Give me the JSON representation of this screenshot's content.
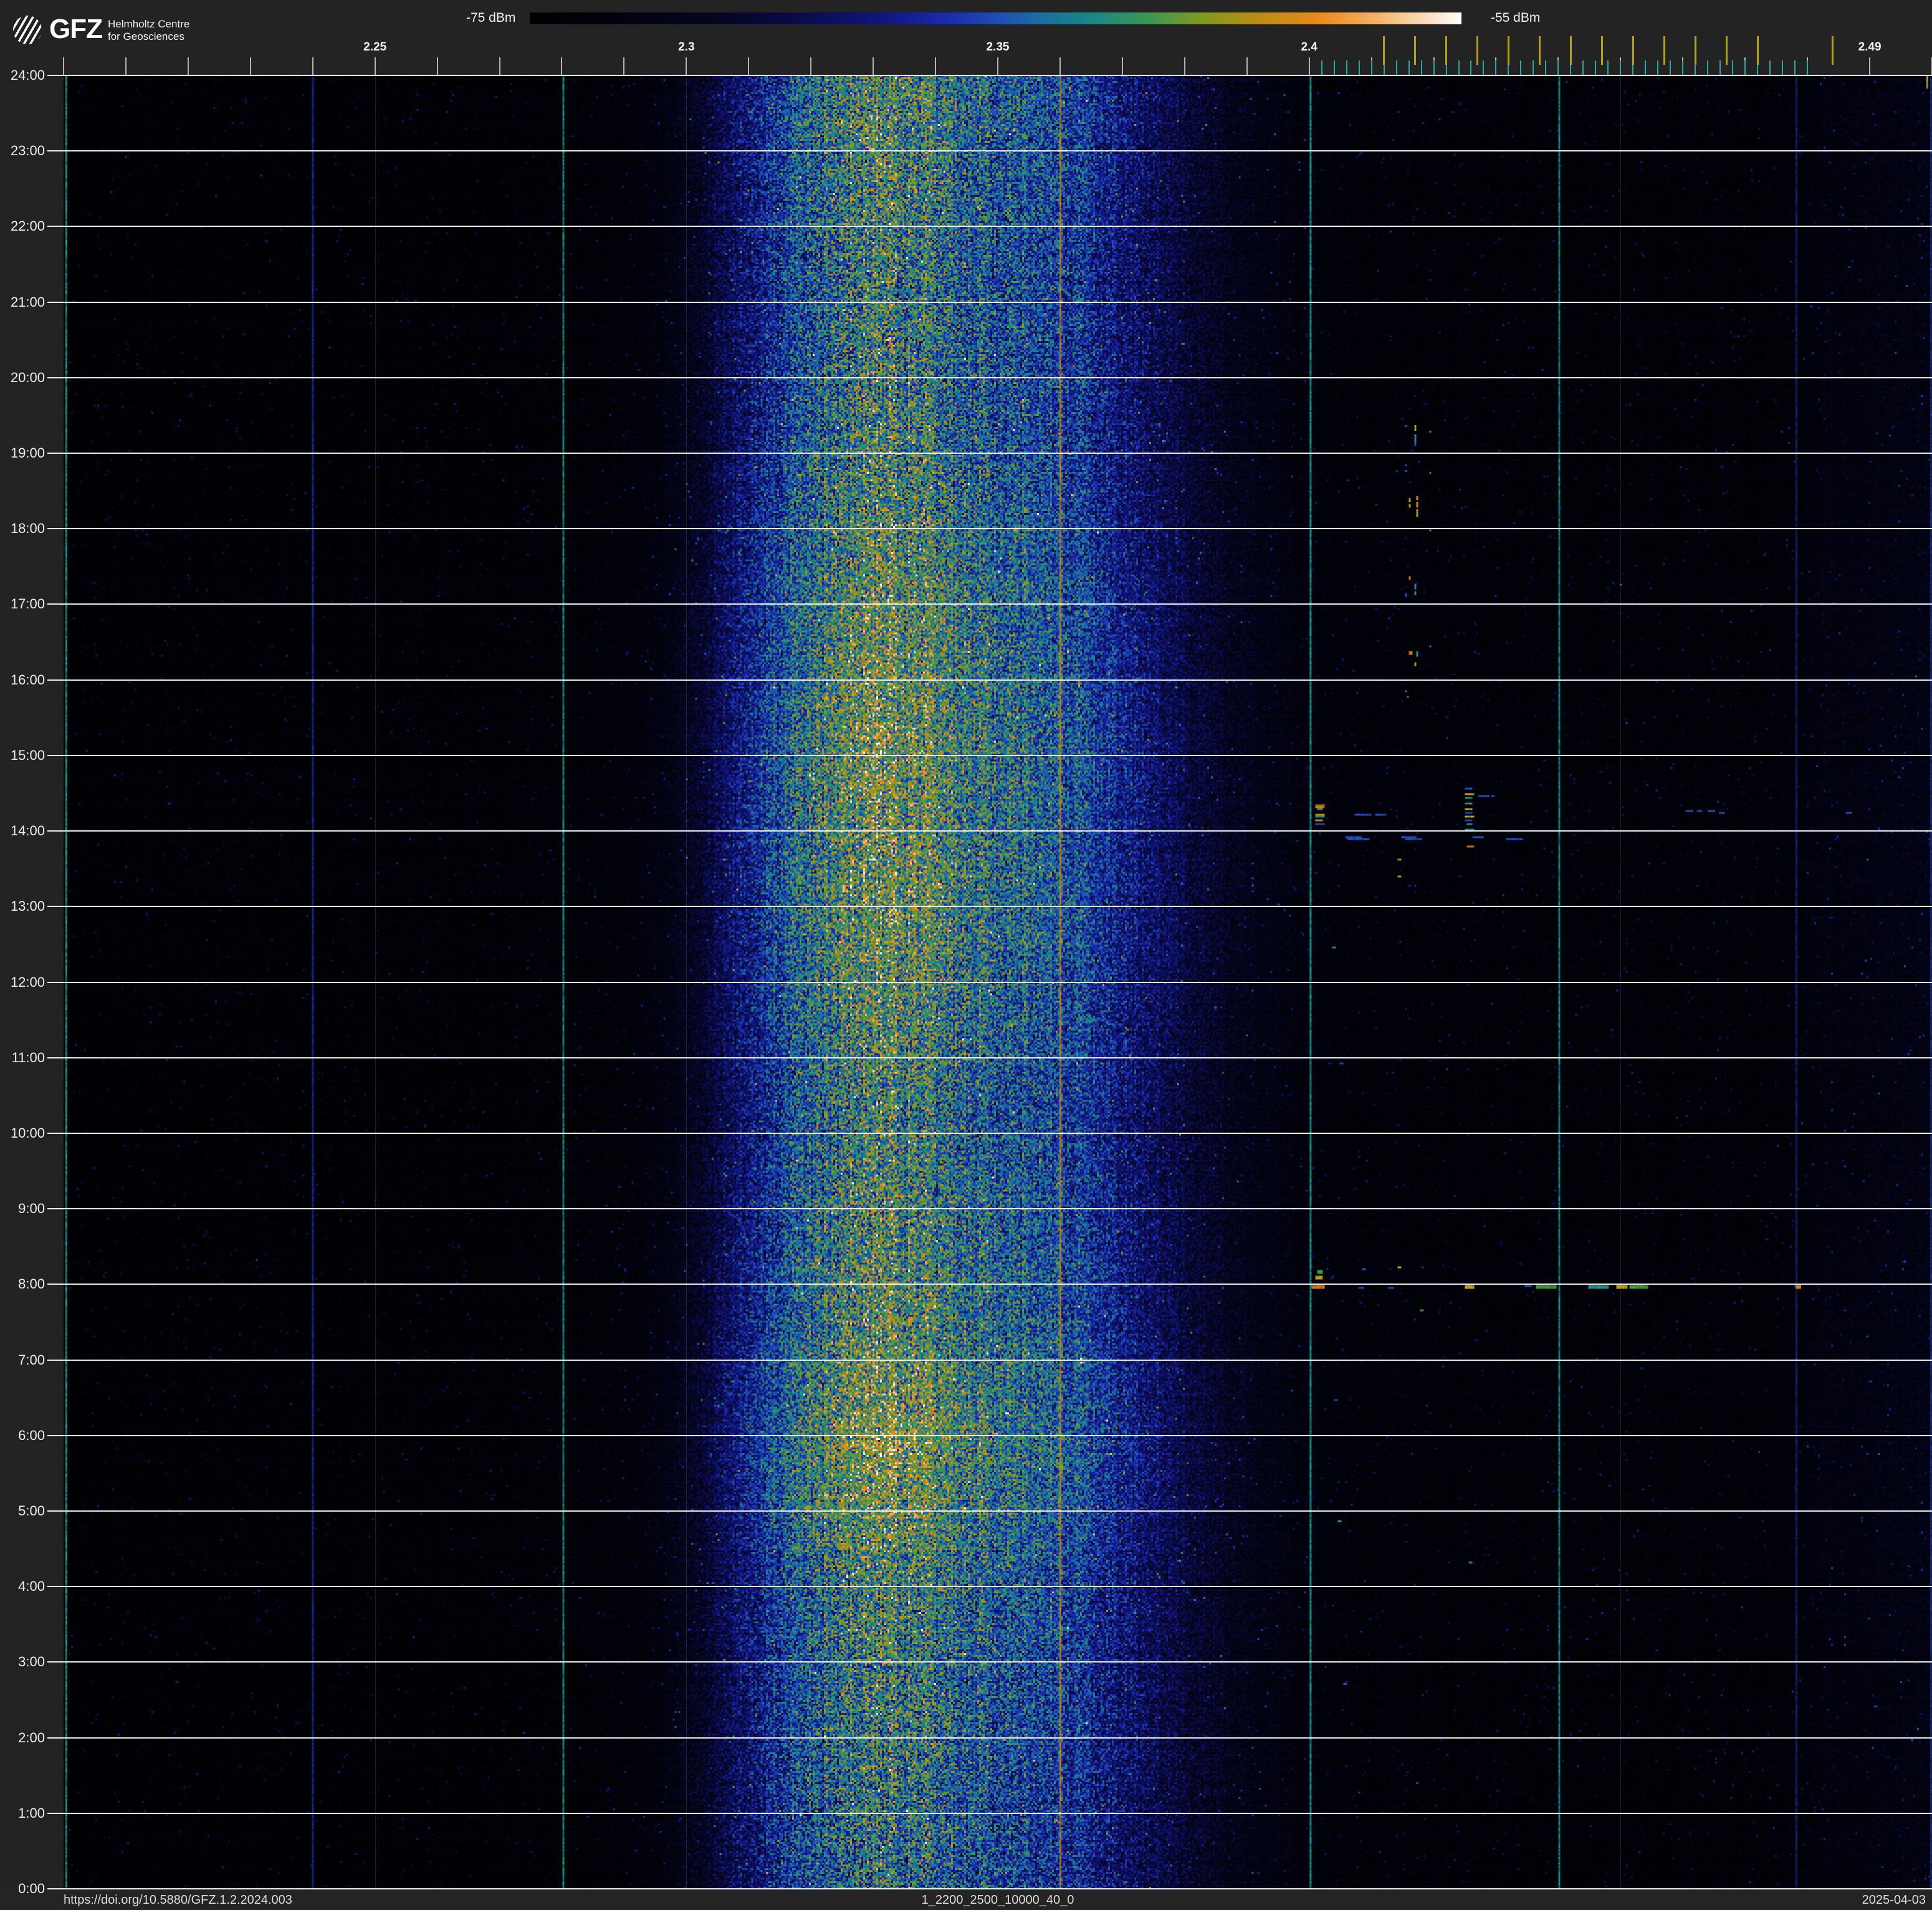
{
  "header": {
    "logo": {
      "org": "GFZ",
      "line1": "Helmholtz Centre",
      "line2": "for Geosciences"
    },
    "colorbar": {
      "min_label": "-75 dBm",
      "max_label": "-55 dBm"
    }
  },
  "footer": {
    "doi": "https://doi.org/10.5880/GFZ.1.2.2024.003",
    "filename": "1_2200_2500_10000_40_0",
    "date": "2025-04-03"
  },
  "chart_data": {
    "type": "heatmap",
    "subtype": "radio-spectrum-waterfall",
    "description": "24-hour RF spectrogram 2.2-2.5 GHz; broadband emission band around 2.30-2.39 GHz, persistent narrowband carriers, Bluetooth/WiFi channel markers on top axis, sporadic WiFi/BLE bursts near 2.4-2.48 GHz.",
    "x_axis": {
      "unit": "GHz",
      "min_mhz": 2200,
      "max_mhz": 2500,
      "major_tick_step_mhz": 10,
      "labeled_ticks": [
        {
          "mhz": 2250,
          "label": "2.25"
        },
        {
          "mhz": 2300,
          "label": "2.3"
        },
        {
          "mhz": 2350,
          "label": "2.35"
        },
        {
          "mhz": 2400,
          "label": "2.4"
        },
        {
          "mhz": 2490,
          "label": "2.49"
        }
      ],
      "gridline_mhz": [
        2250,
        2300,
        2350,
        2400,
        2450
      ]
    },
    "y_axis": {
      "unit": "time of day",
      "top": "24:00",
      "bottom": "0:00",
      "hour_labels": [
        "24:00",
        "23:00",
        "22:00",
        "21:00",
        "20:00",
        "19:00",
        "18:00",
        "17:00",
        "16:00",
        "15:00",
        "14:00",
        "13:00",
        "12:00",
        "11:00",
        "10:00",
        "9:00",
        "8:00",
        "7:00",
        "6:00",
        "5:00",
        "4:00",
        "3:00",
        "2:00",
        "1:00",
        "0:00"
      ]
    },
    "color_scale": {
      "min_dbm": -75,
      "max_dbm": -55,
      "stops": [
        [
          0.0,
          "#000000"
        ],
        [
          0.1,
          "#020210"
        ],
        [
          0.2,
          "#05051f"
        ],
        [
          0.3,
          "#0a0c50"
        ],
        [
          0.38,
          "#10167e"
        ],
        [
          0.45,
          "#1a2cb0"
        ],
        [
          0.5,
          "#1d4cb4"
        ],
        [
          0.55,
          "#1a6f9e"
        ],
        [
          0.6,
          "#178787"
        ],
        [
          0.66,
          "#3a9556"
        ],
        [
          0.72,
          "#7f9a1f"
        ],
        [
          0.78,
          "#b88c12"
        ],
        [
          0.85,
          "#ec8a1e"
        ],
        [
          0.91,
          "#f5b469"
        ],
        [
          0.96,
          "#fbdcb8"
        ],
        [
          1.0,
          "#ffffff"
        ]
      ]
    },
    "channel_markers": {
      "bluetooth_mhz": {
        "start": 2402,
        "end": 2480,
        "step": 2
      },
      "wifi_mhz": [
        2412,
        2417,
        2422,
        2427,
        2432,
        2437,
        2442,
        2447,
        2452,
        2457,
        2462,
        2467,
        2472,
        2484
      ]
    },
    "broadband_emission": {
      "profile_mhz_level": [
        [
          2200,
          0.03
        ],
        [
          2230,
          0.032
        ],
        [
          2260,
          0.036
        ],
        [
          2280,
          0.042
        ],
        [
          2290,
          0.06
        ],
        [
          2296,
          0.1
        ],
        [
          2302,
          0.2
        ],
        [
          2308,
          0.34
        ],
        [
          2314,
          0.45
        ],
        [
          2320,
          0.55
        ],
        [
          2326,
          0.62
        ],
        [
          2332,
          0.65
        ],
        [
          2337,
          0.62
        ],
        [
          2342,
          0.57
        ],
        [
          2348,
          0.55
        ],
        [
          2354,
          0.51
        ],
        [
          2360,
          0.48
        ],
        [
          2366,
          0.42
        ],
        [
          2372,
          0.35
        ],
        [
          2378,
          0.28
        ],
        [
          2384,
          0.21
        ],
        [
          2390,
          0.15
        ],
        [
          2396,
          0.1
        ],
        [
          2402,
          0.07
        ],
        [
          2410,
          0.058
        ],
        [
          2420,
          0.052
        ],
        [
          2440,
          0.049
        ],
        [
          2460,
          0.049
        ],
        [
          2475,
          0.052
        ],
        [
          2479,
          0.07
        ],
        [
          2482,
          0.095
        ],
        [
          2490,
          0.1
        ],
        [
          2496,
          0.115
        ],
        [
          2500,
          0.13
        ]
      ],
      "hourly_intensity": [
        [
          0,
          0.88
        ],
        [
          1,
          0.9
        ],
        [
          2,
          0.93
        ],
        [
          3,
          0.95
        ],
        [
          4,
          0.97
        ],
        [
          5,
          1.07
        ],
        [
          6,
          1.13
        ],
        [
          7,
          1.06
        ],
        [
          8,
          1.02
        ],
        [
          9,
          0.99
        ],
        [
          10,
          0.96
        ],
        [
          11,
          0.98
        ],
        [
          12,
          1.03
        ],
        [
          13,
          1.06
        ],
        [
          14,
          1.05
        ],
        [
          15,
          1.09
        ],
        [
          16,
          1.06
        ],
        [
          17,
          1.04
        ],
        [
          18,
          1.0
        ],
        [
          19,
          0.97
        ],
        [
          20,
          0.94
        ],
        [
          21,
          0.93
        ],
        [
          22,
          0.96
        ],
        [
          23,
          0.99
        ],
        [
          24,
          1.0
        ]
      ]
    },
    "carriers": [
      {
        "mhz": 2200.2,
        "color": "#1ba893",
        "alpha": 0.95,
        "w": 3,
        "note": "left edge line"
      },
      {
        "mhz": 2240.0,
        "color": "#1733cf",
        "alpha": 0.8,
        "w": 2
      },
      {
        "mhz": 2280.0,
        "color": "#18a393",
        "alpha": 0.9,
        "w": 2
      },
      {
        "mhz": 2360.0,
        "color": "#d8861b",
        "alpha": 0.95,
        "w": 3
      },
      {
        "mhz": 2400.0,
        "color": "#17a8a6",
        "alpha": 0.9,
        "w": 3
      },
      {
        "mhz": 2440.0,
        "color": "#18a8a6",
        "alpha": 0.85,
        "w": 3
      },
      {
        "mhz": 2478.2,
        "color": "#2b4ed8",
        "alpha": 0.45,
        "w": 2
      },
      {
        "mhz": 2499.6,
        "color": "#2d55e0",
        "alpha": 0.5,
        "w": 3,
        "note": "right edge column"
      }
    ],
    "burst_palette": {
      "bl": "#2552d2",
      "te": "#2a9a8f",
      "gr": "#49a43a",
      "ye": "#c9a81e",
      "or": "#e0861a",
      "tg": "#37a06a"
    },
    "bursts": [
      [
        2401.2,
        14.35,
        14,
        5,
        "or"
      ],
      [
        2401.3,
        14.3,
        10,
        4,
        "tg"
      ],
      [
        2401.1,
        14.22,
        16,
        3,
        "ye"
      ],
      [
        2401.1,
        14.19,
        14,
        3,
        "te"
      ],
      [
        2401.2,
        14.14,
        12,
        4,
        "ye"
      ],
      [
        2401.1,
        14.11,
        14,
        3,
        "bl"
      ],
      [
        2407.4,
        14.22,
        26,
        3,
        "bl"
      ],
      [
        2410.6,
        14.22,
        18,
        3,
        "bl"
      ],
      [
        2425.1,
        14.56,
        12,
        3,
        "bl"
      ],
      [
        2425.1,
        14.5,
        14,
        3,
        "ye"
      ],
      [
        2425.1,
        14.44,
        12,
        3,
        "te"
      ],
      [
        2425.1,
        14.37,
        13,
        3,
        "te"
      ],
      [
        2425.2,
        14.31,
        12,
        3,
        "ye"
      ],
      [
        2425.1,
        14.26,
        12,
        3,
        "bl"
      ],
      [
        2425.1,
        14.2,
        14,
        4,
        "ye"
      ],
      [
        2425.1,
        14.14,
        12,
        3,
        "bl"
      ],
      [
        2425.4,
        14.09,
        9,
        3,
        "te"
      ],
      [
        2425.1,
        14.02,
        14,
        3,
        "te"
      ],
      [
        2425.4,
        13.8,
        12,
        4,
        "or"
      ],
      [
        2427.2,
        14.48,
        8,
        3,
        "bl"
      ],
      [
        2428.3,
        14.48,
        10,
        3,
        "bl"
      ],
      [
        2429.5,
        14.48,
        6,
        3,
        "bl"
      ],
      [
        2405.9,
        13.93,
        28,
        3,
        "bl"
      ],
      [
        2414.9,
        13.93,
        24,
        3,
        "bl"
      ],
      [
        2406.1,
        13.89,
        36,
        3,
        "bl"
      ],
      [
        2415.4,
        13.89,
        28,
        3,
        "bl"
      ],
      [
        2426.4,
        13.93,
        18,
        3,
        "bl"
      ],
      [
        2431.9,
        13.91,
        26,
        3,
        "bl"
      ],
      [
        2414.2,
        13.64,
        5,
        3,
        "ye"
      ],
      [
        2414.2,
        13.4,
        5,
        3,
        "ye"
      ],
      [
        2460.7,
        14.27,
        13,
        3,
        "bl"
      ],
      [
        2462.5,
        14.27,
        10,
        3,
        "bl"
      ],
      [
        2464.3,
        14.27,
        12,
        3,
        "bl"
      ],
      [
        2466.1,
        14.26,
        8,
        3,
        "bl"
      ],
      [
        2486.4,
        14.26,
        10,
        3,
        "bl"
      ],
      [
        2415.6,
        19.38,
        3,
        3,
        "bl"
      ],
      [
        2417.1,
        19.36,
        4,
        9,
        "ye"
      ],
      [
        2417.1,
        19.26,
        3,
        12,
        "te"
      ],
      [
        2417.1,
        19.15,
        3,
        7,
        "bl"
      ],
      [
        2419.5,
        19.29,
        4,
        3,
        "te"
      ],
      [
        2415.6,
        18.84,
        3,
        4,
        "bl"
      ],
      [
        2415.6,
        18.77,
        3,
        4,
        "bl"
      ],
      [
        2419.4,
        18.76,
        4,
        3,
        "te"
      ],
      [
        2416.1,
        18.41,
        4,
        5,
        "ye"
      ],
      [
        2416.1,
        18.34,
        3,
        5,
        "ye"
      ],
      [
        2417.2,
        18.42,
        4,
        6,
        "or"
      ],
      [
        2417.2,
        18.35,
        4,
        8,
        "or"
      ],
      [
        2417.2,
        18.27,
        4,
        5,
        "ye"
      ],
      [
        2417.2,
        18.21,
        4,
        6,
        "ye"
      ],
      [
        2419.5,
        17.98,
        4,
        3,
        "te"
      ],
      [
        2416.1,
        17.36,
        4,
        6,
        "or"
      ],
      [
        2417.1,
        17.28,
        3,
        10,
        "te"
      ],
      [
        2417.1,
        17.17,
        3,
        7,
        "te"
      ],
      [
        2415.6,
        17.14,
        3,
        5,
        "bl"
      ],
      [
        2450.2,
        17.28,
        4,
        3,
        "te"
      ],
      [
        2419.5,
        16.45,
        4,
        3,
        "te"
      ],
      [
        2416.1,
        16.37,
        5,
        7,
        "or"
      ],
      [
        2417.2,
        16.38,
        3,
        8,
        "te"
      ],
      [
        2417.1,
        16.24,
        4,
        6,
        "ye"
      ],
      [
        2415.6,
        15.85,
        3,
        4,
        "te"
      ],
      [
        2415.7,
        15.78,
        3,
        4,
        "te"
      ],
      [
        2451.0,
        15.43,
        4,
        3,
        "bl"
      ],
      [
        2401.4,
        8.18,
        8,
        5,
        "gr"
      ],
      [
        2401.2,
        8.12,
        11,
        6,
        "ye"
      ],
      [
        2408.5,
        8.2,
        5,
        4,
        "bl"
      ],
      [
        2414.3,
        8.24,
        5,
        3,
        "ye"
      ],
      [
        2400.6,
        7.99,
        22,
        6,
        "or"
      ],
      [
        2407.9,
        7.97,
        8,
        3,
        "bl"
      ],
      [
        2412.9,
        7.97,
        10,
        3,
        "bl"
      ],
      [
        2425.0,
        7.99,
        16,
        6,
        "ye"
      ],
      [
        2434.8,
        7.98,
        12,
        4,
        "bl"
      ],
      [
        2436.7,
        7.99,
        32,
        5,
        "gr"
      ],
      [
        2444.9,
        7.98,
        34,
        5,
        "te"
      ],
      [
        2449.5,
        7.99,
        19,
        6,
        "ye"
      ],
      [
        2451.6,
        7.99,
        30,
        5,
        "gr"
      ],
      [
        2478.2,
        7.98,
        8,
        5,
        "or"
      ],
      [
        2417.9,
        7.66,
        5,
        3,
        "gr"
      ],
      [
        2403.9,
        12.46,
        5,
        3,
        "te"
      ],
      [
        2404.9,
        10.93,
        5,
        3,
        "bl"
      ],
      [
        2404.0,
        6.48,
        5,
        3,
        "bl"
      ],
      [
        2404.7,
        4.87,
        5,
        3,
        "te"
      ],
      [
        2405.5,
        2.72,
        5,
        3,
        "bl"
      ],
      [
        2425.9,
        4.33,
        5,
        3,
        "te"
      ],
      [
        2417.3,
        1.4,
        4,
        3,
        "bl"
      ],
      [
        2499.4,
        23.99,
        4,
        20,
        "ye"
      ]
    ]
  }
}
